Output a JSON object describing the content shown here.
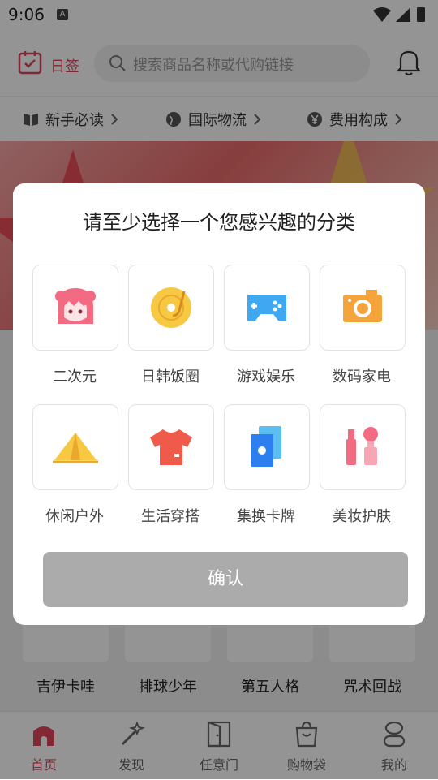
{
  "status_bar": {
    "time": "9:06",
    "notif_badge": "A"
  },
  "header": {
    "checkin_label": "日签",
    "search_placeholder": "搜索商品名称或代购链接",
    "icons": [
      "calendar-check-icon",
      "search-icon",
      "bell-icon"
    ]
  },
  "guide_links": [
    {
      "label": "新手必读",
      "icon": "book-icon"
    },
    {
      "label": "国际物流",
      "icon": "globe-icon"
    },
    {
      "label": "费用构成",
      "icon": "yen-icon"
    }
  ],
  "background_categories": [
    "吉伊卡哇",
    "排球少年",
    "第五人格",
    "咒术回战"
  ],
  "bottom_nav": [
    {
      "label": "首页",
      "icon": "home-icon",
      "active": true
    },
    {
      "label": "发现",
      "icon": "magic-wand-icon",
      "active": false
    },
    {
      "label": "任意门",
      "icon": "door-icon",
      "active": false
    },
    {
      "label": "购物袋",
      "icon": "shopping-bag-icon",
      "active": false
    },
    {
      "label": "我的",
      "icon": "profile-icon",
      "active": false
    }
  ],
  "dialog": {
    "title": "请至少选择一个您感兴趣的分类",
    "categories": [
      {
        "label": "二次元",
        "icon": "anime-girl-icon"
      },
      {
        "label": "日韩饭圈",
        "icon": "vinyl-record-icon"
      },
      {
        "label": "游戏娱乐",
        "icon": "gamepad-icon"
      },
      {
        "label": "数码家电",
        "icon": "camera-icon"
      },
      {
        "label": "休闲户外",
        "icon": "tent-icon"
      },
      {
        "label": "生活穿搭",
        "icon": "tshirt-icon"
      },
      {
        "label": "集换卡牌",
        "icon": "trading-cards-icon"
      },
      {
        "label": "美妆护肤",
        "icon": "cosmetics-icon"
      }
    ],
    "confirm_label": "确认"
  },
  "colors": {
    "accent": "#e0465a",
    "confirm_disabled": "#ababab"
  }
}
